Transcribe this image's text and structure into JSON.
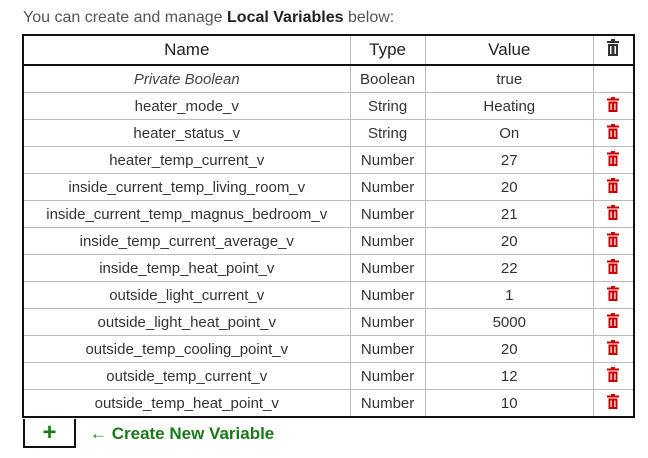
{
  "intro": {
    "prefix": "You can create and manage ",
    "bold": "Local Variables",
    "suffix": " below:"
  },
  "table": {
    "headers": {
      "name": "Name",
      "type": "Type",
      "value": "Value",
      "actions_icon": "trash-icon"
    },
    "rows": [
      {
        "name": "Private Boolean",
        "type": "Boolean",
        "value": "true",
        "deletable": false,
        "italic": true
      },
      {
        "name": "heater_mode_v",
        "type": "String",
        "value": "Heating",
        "deletable": true
      },
      {
        "name": "heater_status_v",
        "type": "String",
        "value": "On",
        "deletable": true
      },
      {
        "name": "heater_temp_current_v",
        "type": "Number",
        "value": "27",
        "deletable": true
      },
      {
        "name": "inside_current_temp_living_room_v",
        "type": "Number",
        "value": "20",
        "deletable": true
      },
      {
        "name": "inside_current_temp_magnus_bedroom_v",
        "type": "Number",
        "value": "21",
        "deletable": true
      },
      {
        "name": "inside_temp_current_average_v",
        "type": "Number",
        "value": "20",
        "deletable": true
      },
      {
        "name": "inside_temp_heat_point_v",
        "type": "Number",
        "value": "22",
        "deletable": true
      },
      {
        "name": "outside_light_current_v",
        "type": "Number",
        "value": "1",
        "deletable": true
      },
      {
        "name": "outside_light_heat_point_v",
        "type": "Number",
        "value": "5000",
        "deletable": true
      },
      {
        "name": "outside_temp_cooling_point_v",
        "type": "Number",
        "value": "20",
        "deletable": true
      },
      {
        "name": "outside_temp_current_v",
        "type": "Number",
        "value": "12",
        "deletable": true
      },
      {
        "name": "outside_temp_heat_point_v",
        "type": "Number",
        "value": "10",
        "deletable": true
      }
    ]
  },
  "add": {
    "plus_label": "+",
    "create_label": "← Create New Variable"
  },
  "colors": {
    "value": "#8b1a9a",
    "delete": "#cc0000",
    "create": "#1a7a1a"
  }
}
